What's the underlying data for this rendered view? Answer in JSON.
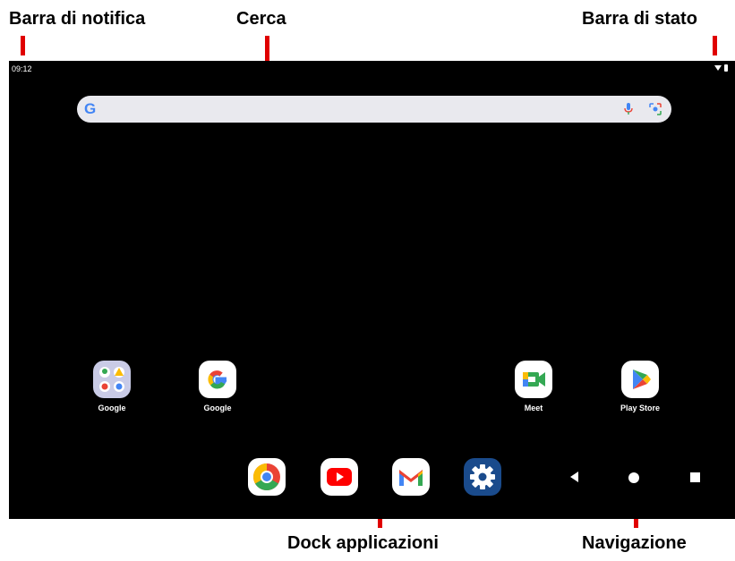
{
  "labels": {
    "notification_bar": "Barra di notifica",
    "search": "Cerca",
    "status_bar": "Barra di stato",
    "app_dock": "Dock applicazioni",
    "navigation": "Navigazione"
  },
  "status": {
    "time": "09:12"
  },
  "search": {
    "logo": "G"
  },
  "home_apps": [
    {
      "label": "Google",
      "icon": "google-folder-icon"
    },
    {
      "label": "Google",
      "icon": "google-g-icon"
    },
    {
      "label": "Meet",
      "icon": "meet-icon"
    },
    {
      "label": "Play Store",
      "icon": "play-store-icon"
    }
  ],
  "dock_apps": [
    {
      "icon": "chrome-icon"
    },
    {
      "icon": "youtube-icon"
    },
    {
      "icon": "gmail-icon"
    },
    {
      "icon": "settings-icon"
    }
  ],
  "navigation_buttons": [
    "back",
    "home",
    "recents"
  ],
  "colors": {
    "screen_bg": "#000000",
    "pointer": "#e00000",
    "search_bg": "#e9e9ee",
    "google_blue": "#4285f4",
    "google_red": "#ea4335",
    "google_yellow": "#fbbc05",
    "google_green": "#34a853",
    "settings_blue": "#1a4b8c"
  }
}
